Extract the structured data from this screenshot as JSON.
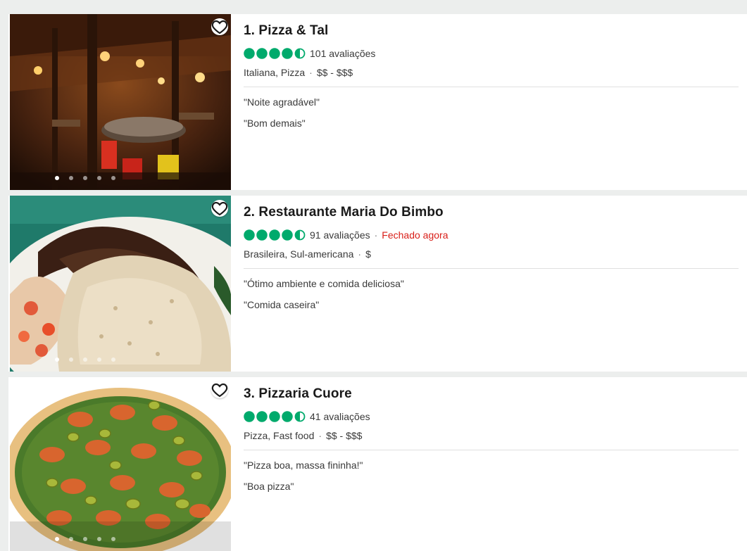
{
  "colors": {
    "bubble_green": "#00aa6c",
    "closed_red": "#d91e18"
  },
  "icons": {
    "favorite": "heart-outline-icon",
    "rating": "rating-bubble-icon"
  },
  "restaurants": [
    {
      "title": "1. Pizza & Tal",
      "rating": 4.5,
      "reviews": "101 avaliações",
      "status": "",
      "cuisine": "Italiana, Pizza",
      "price": "$$ - $$$",
      "snippets": [
        "\"Noite agradável\"",
        "\"Bom demais\""
      ],
      "photo_count": 5,
      "photo_index": 1
    },
    {
      "title": "2. Restaurante Maria Do Bimbo",
      "rating": 4.5,
      "reviews": "91 avaliações",
      "status": "Fechado agora",
      "cuisine": "Brasileira, Sul-americana",
      "price": "$",
      "snippets": [
        "\"Ótimo ambiente e comida deliciosa\"",
        "\"Comida caseira\""
      ],
      "photo_count": 5,
      "photo_index": 1
    },
    {
      "title": "3. Pizzaria Cuore",
      "rating": 4.5,
      "reviews": "41 avaliações",
      "status": "",
      "cuisine": "Pizza, Fast food",
      "price": "$$ - $$$",
      "snippets": [
        "\"Pizza boa, massa fininha!\"",
        "\"Boa pizza\""
      ],
      "photo_count": 5,
      "photo_index": 1
    }
  ]
}
